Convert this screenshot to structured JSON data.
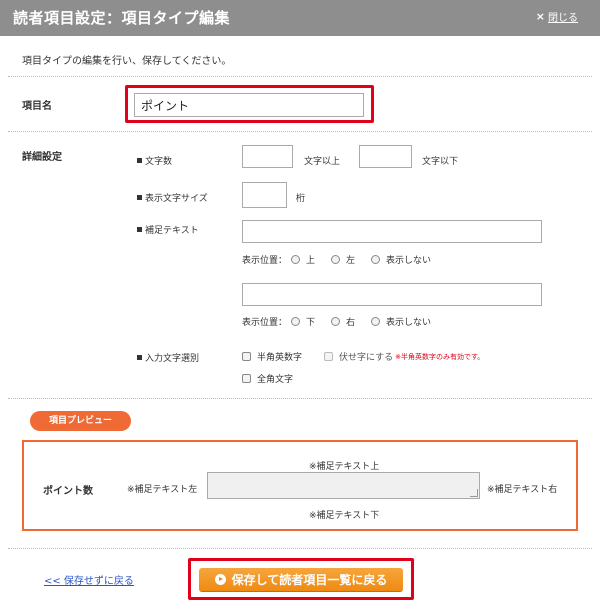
{
  "header": {
    "title": "読者項目設定：項目タイプ編集",
    "close_symbol": "×",
    "close_label": "閉じる"
  },
  "intro": "項目タイプの編集を行い、保存してください。",
  "item_name": {
    "label": "項目名",
    "value": "ポイント"
  },
  "details": {
    "label": "詳細設定",
    "char_count": {
      "label": "文字数",
      "min_suffix": "文字以上",
      "max_suffix": "文字以下",
      "min_value": "",
      "max_value": ""
    },
    "display_size": {
      "label": "表示文字サイズ",
      "suffix": "桁",
      "value": ""
    },
    "supplement": {
      "label": "補足テキスト",
      "text1": "",
      "position1_label": "表示位置：",
      "position1_options": [
        "上",
        "左",
        "表示しない"
      ],
      "text2": "",
      "position2_label": "表示位置：",
      "position2_options": [
        "下",
        "右",
        "表示しない"
      ]
    },
    "input_type": {
      "label": "入力文字選別",
      "opt_halfwidth": "半角英数字",
      "opt_mask": "伏せ字にする",
      "mask_note": "※半角英数字のみ有効です。",
      "opt_fullwidth": "全角文字"
    }
  },
  "preview": {
    "tab_label": "項目プレビュー",
    "field_label": "ポイント数",
    "note_top": "※補足テキスト上",
    "note_left": "※補足テキスト左",
    "note_right": "※補足テキスト右",
    "note_bottom": "※補足テキスト下"
  },
  "footer": {
    "back_link": "<< 保存せずに戻る",
    "save_button": "保存して読者項目一覧に戻る"
  },
  "colors": {
    "header_bg": "#8e8e8e",
    "highlight_red": "#e1001a",
    "preview_orange": "#f06a35",
    "button_orange": "#ee8a12"
  }
}
